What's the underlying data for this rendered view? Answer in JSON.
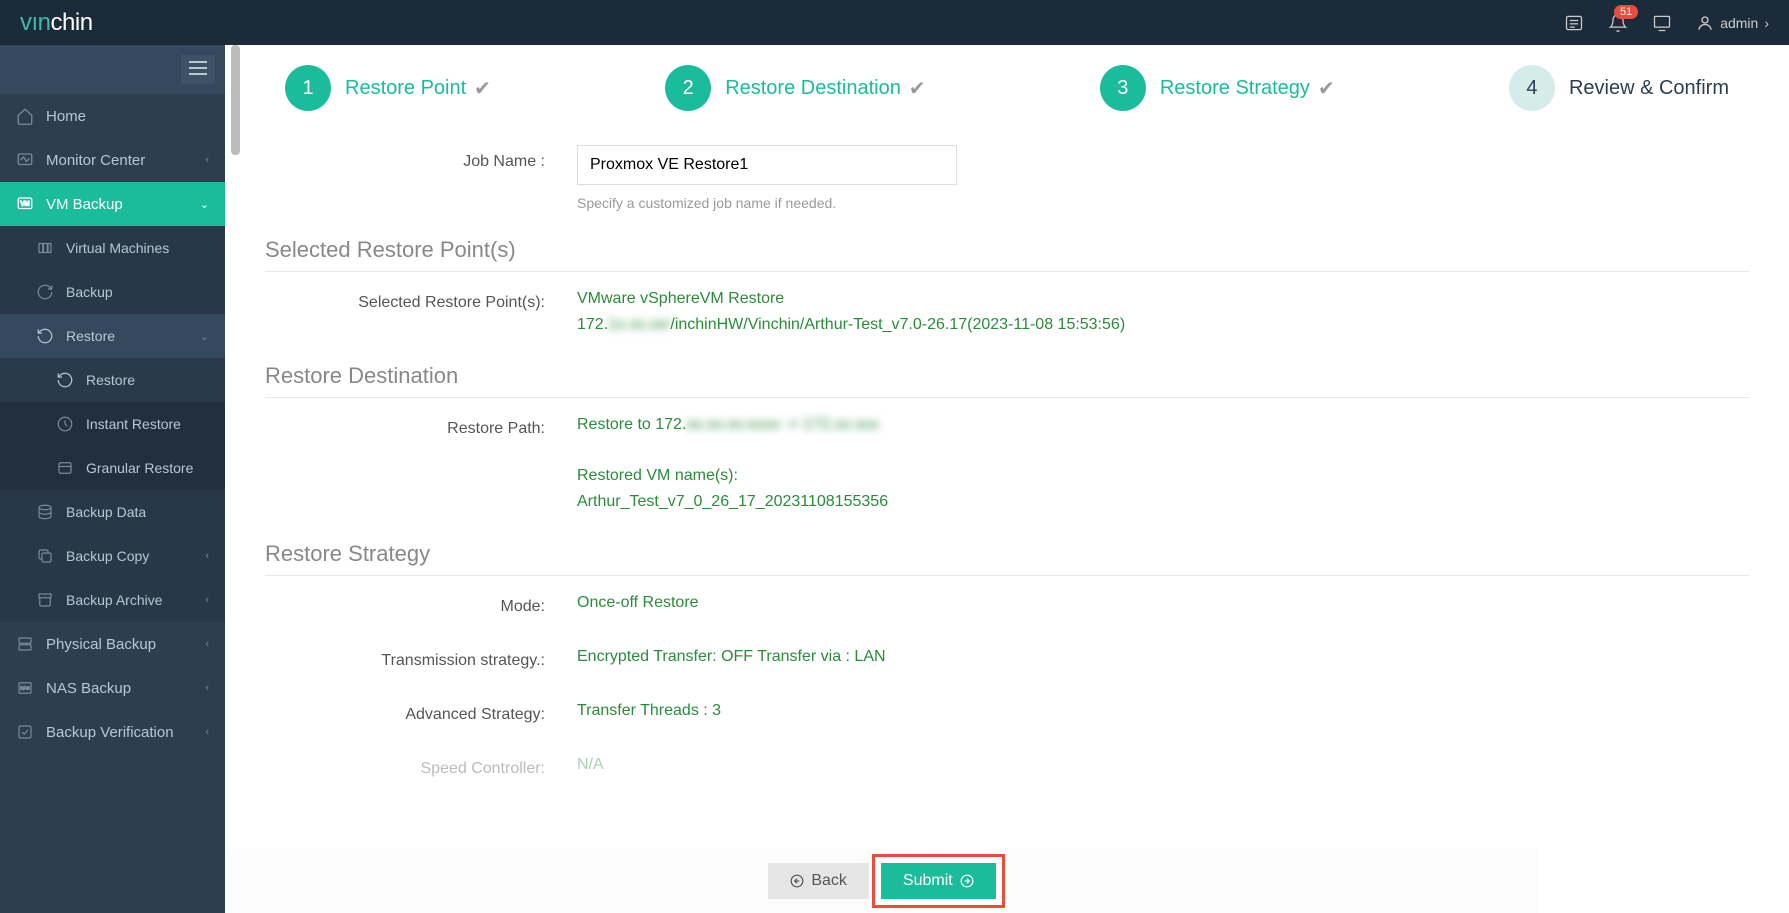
{
  "topbar": {
    "logo_pre": "vın",
    "logo_post": "chin",
    "notif_count": "51",
    "user_label": "admin"
  },
  "sidebar": {
    "home": "Home",
    "monitor": "Monitor Center",
    "vm_backup": "VM Backup",
    "virtual_machines": "Virtual Machines",
    "backup": "Backup",
    "restore": "Restore",
    "restore_sub": "Restore",
    "instant_restore": "Instant Restore",
    "granular_restore": "Granular Restore",
    "backup_data": "Backup Data",
    "backup_copy": "Backup Copy",
    "backup_archive": "Backup Archive",
    "physical_backup": "Physical Backup",
    "nas_backup": "NAS Backup",
    "backup_verification": "Backup Verification"
  },
  "steps": [
    {
      "num": "1",
      "label": "Restore Point",
      "done": true
    },
    {
      "num": "2",
      "label": "Restore Destination",
      "done": true
    },
    {
      "num": "3",
      "label": "Restore Strategy",
      "done": true
    },
    {
      "num": "4",
      "label": "Review & Confirm",
      "done": false
    }
  ],
  "form": {
    "job_name_label": "Job Name :",
    "job_name_value": "Proxmox VE Restore1",
    "job_name_help": "Specify a customized job name if needed."
  },
  "selected_points": {
    "title": "Selected Restore Point(s)",
    "label": "Selected Restore Point(s):",
    "line1": "VMware vSphereVM Restore",
    "line2_prefix": "172.",
    "line2_blur": "1x.xx.xx/",
    "line2_suffix": "/inchinHW/Vinchin/Arthur-Test_v7.0-26.17(2023-11-08 15:53:56)"
  },
  "destination": {
    "title": "Restore Destination",
    "path_label": "Restore Path:",
    "path_prefix": "Restore to 172.",
    "path_blur": "xx.xx.xx:xxxx -> 172.xx.xxx",
    "vm_names_label": "Restored VM name(s):",
    "vm_name": "Arthur_Test_v7_0_26_17_20231108155356"
  },
  "strategy": {
    "title": "Restore Strategy",
    "mode_label": "Mode:",
    "mode_value": "Once-off Restore",
    "trans_label": "Transmission strategy.:",
    "trans_value": "Encrypted Transfer: OFF Transfer via : LAN",
    "adv_label": "Advanced Strategy:",
    "adv_value": "Transfer Threads : 3",
    "speed_label": "Speed Controller:",
    "speed_value": "N/A"
  },
  "buttons": {
    "back": "Back",
    "submit": "Submit"
  }
}
